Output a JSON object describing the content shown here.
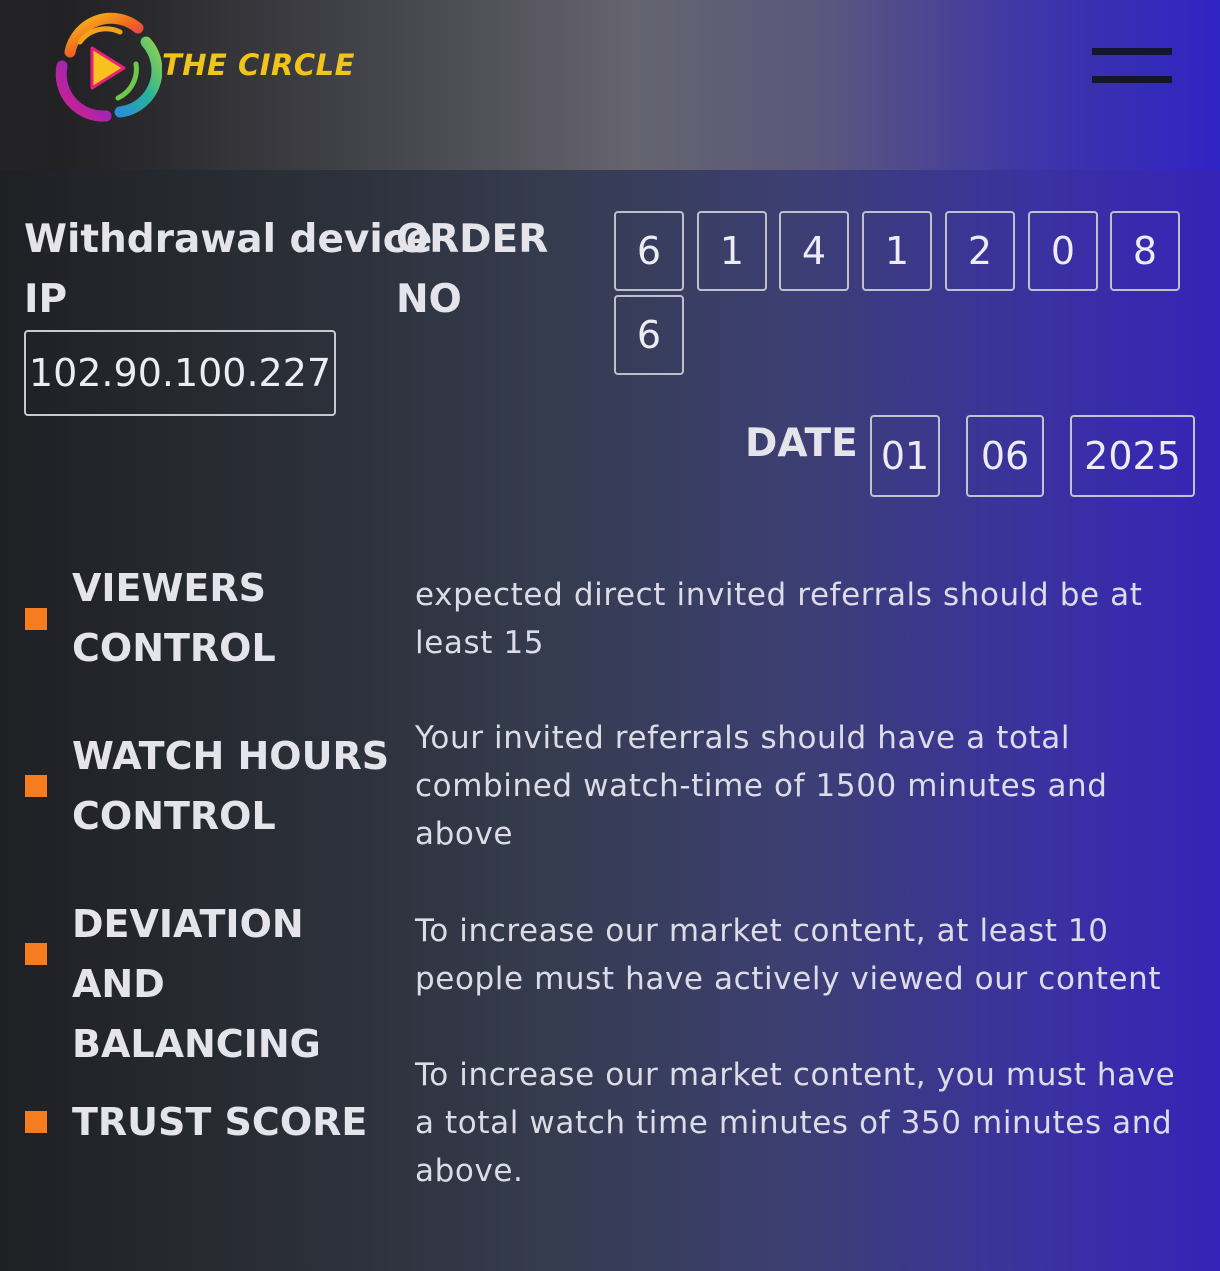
{
  "header": {
    "brand": "THE CIRCLE",
    "logo_icon": "circle-play-logo",
    "menu_icon": "hamburger-menu-icon"
  },
  "withdrawal_ip": {
    "label_line1": "Withdrawal device",
    "label_line2": "IP",
    "value": "102.90.100.227"
  },
  "order": {
    "label_line1": "ORDER",
    "label_line2": "NO",
    "digits": [
      "6",
      "1",
      "4",
      "1",
      "2",
      "0",
      "8",
      "6"
    ]
  },
  "date": {
    "label": "DATE",
    "day": "01",
    "month": "06",
    "year": "2025"
  },
  "rules": [
    {
      "title": "VIEWERS CONTROL",
      "description": "expected direct invited referrals should be at least 15"
    },
    {
      "title": "WATCH HOURS CONTROL",
      "description": "Your invited referrals should have a total combined watch-time of 1500 minutes and above"
    },
    {
      "title": "DEVIATION AND BALANCING",
      "description": "To increase our market content, at least 10 people must have actively viewed our content"
    },
    {
      "title": "TRUST SCORE",
      "description": "To increase our market content, you must have a total watch time minutes of 350 minutes and above."
    }
  ],
  "colors": {
    "accent_bullet": "#f57c1f",
    "brand_text": "#f0c419",
    "bg_start": "#1f2024",
    "bg_end": "#3623b8"
  }
}
